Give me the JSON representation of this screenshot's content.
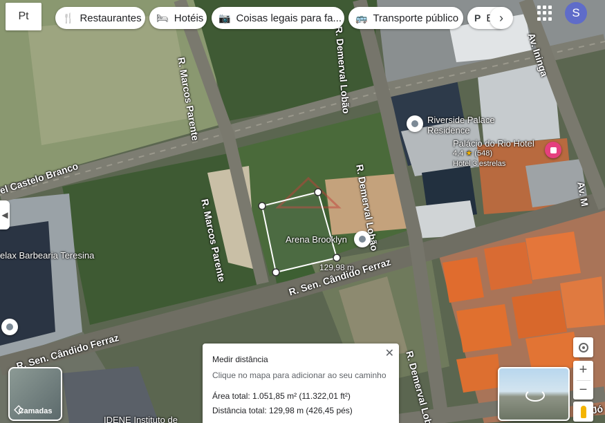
{
  "topbar": {
    "left_button_text": "Pt",
    "chips": [
      {
        "icon": "fork-knife-icon",
        "label": "Restaurantes"
      },
      {
        "icon": "bed-icon",
        "label": "Hotéis"
      },
      {
        "icon": "camera-icon",
        "label": "Coisas legais para fa..."
      },
      {
        "icon": "bus-icon",
        "label": "Transporte público"
      },
      {
        "icon": "parking-icon",
        "label": "E"
      }
    ],
    "avatar_letter": "S"
  },
  "map": {
    "streets": [
      {
        "label": "R. Marcos Parente",
        "name": "street-marcos-parente-north"
      },
      {
        "label": "R. Demerval Lobão",
        "name": "street-demerval-north"
      },
      {
        "label": "Av. Ininga",
        "name": "street-ininga"
      },
      {
        "label": "el Castelo Branco",
        "name": "street-castelo-branco"
      },
      {
        "label": "R. Marcos Parente",
        "name": "street-marcos-parente-south"
      },
      {
        "label": "R. Demerval Lobão",
        "name": "street-demerval-mid"
      },
      {
        "label": "R. Sen. Cândido Ferraz",
        "name": "street-candido-ferraz-east"
      },
      {
        "label": "R. Sen. Cândido Ferraz",
        "name": "street-candido-ferraz-west"
      },
      {
        "label": "R. Demerval Lobão",
        "name": "street-demerval-south"
      },
      {
        "label": "Av. M",
        "name": "street-av-m"
      },
      {
        "label": "Av. Jó",
        "name": "street-av-jo"
      }
    ],
    "pois": [
      {
        "label": "Riverside Palace Residence",
        "line1": "Riverside Palace",
        "line2": "Residence"
      },
      {
        "label": "Palácio do Rio Hotel",
        "rating": "4,4",
        "stars": "★",
        "reviews": "(548)",
        "category": "Hotel 3 estrelas"
      },
      {
        "label": "Arena Brooklyn"
      },
      {
        "label": "elax Barbearia Teresina"
      },
      {
        "label": "IDENE Instituto de"
      }
    ],
    "measure_segment_label": "129,98 m"
  },
  "measure_panel": {
    "title": "Medir distância",
    "hint": "Clique no mapa para adicionar ao seu caminho",
    "area": "Área total: 1.051,85 m² (11.322,01 ft²)",
    "distance": "Distância total: 129,98 m (426,45 pés)"
  },
  "layers_button": {
    "label": "Camadas"
  },
  "colors": {
    "hotel_pin": "#e5407e",
    "poi_pin": "#7c8a96",
    "avatar": "#5f6cc9"
  }
}
